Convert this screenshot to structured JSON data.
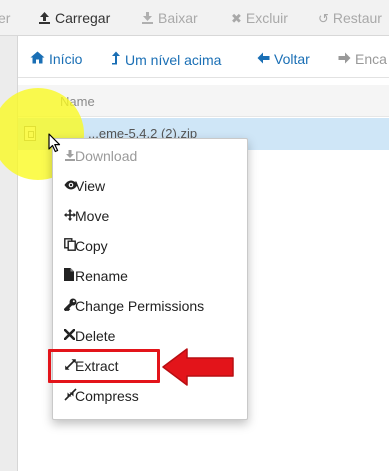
{
  "toolbar": {
    "partial_left": "er",
    "upload": "Carregar",
    "download": "Baixar",
    "delete": "Excluir",
    "restore": "Restaur"
  },
  "nav": {
    "home": "Início",
    "up_one_level": "Um nível acima",
    "back": "Voltar",
    "partial_right": "Enca"
  },
  "file_list": {
    "column_name": "Name",
    "selected_file": "...eme-5.4.2 (2).zip"
  },
  "context_menu": {
    "items": [
      {
        "label": "Download",
        "icon": "download-icon",
        "disabled": true
      },
      {
        "label": "View",
        "icon": "eye-icon"
      },
      {
        "label": "Move",
        "icon": "move-arrows-icon"
      },
      {
        "label": "Copy",
        "icon": "copy-icon"
      },
      {
        "label": "Rename",
        "icon": "file-icon"
      },
      {
        "label": "Change Permissions",
        "icon": "key-icon"
      },
      {
        "label": "Delete",
        "icon": "x-icon"
      },
      {
        "label": "Extract",
        "icon": "expand-arrows-icon",
        "highlighted": true
      },
      {
        "label": "Compress",
        "icon": "compress-arrows-icon"
      }
    ]
  },
  "colors": {
    "link_blue": "#1a6fb5",
    "selected_row": "#cfe6f7",
    "highlight_red": "#e3141a",
    "click_yellow": "#fafa1e"
  }
}
